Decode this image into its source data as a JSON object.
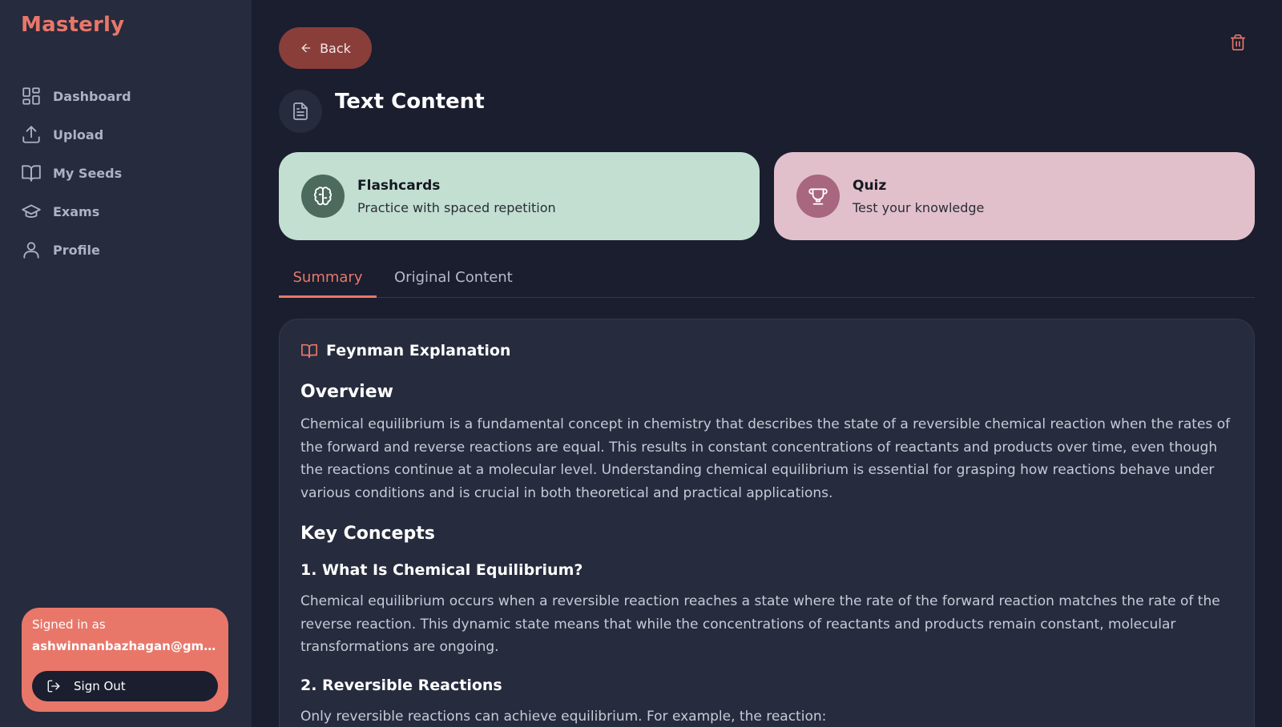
{
  "brand": "Masterly",
  "nav": {
    "items": [
      {
        "label": "Dashboard",
        "icon": "grid-icon"
      },
      {
        "label": "Upload",
        "icon": "upload-icon"
      },
      {
        "label": "My Seeds",
        "icon": "book-icon"
      },
      {
        "label": "Exams",
        "icon": "graduation-cap-icon"
      },
      {
        "label": "Profile",
        "icon": "user-icon"
      }
    ]
  },
  "account": {
    "signed_in_label": "Signed in as",
    "email": "ashwinnanbazhagan@gmai...",
    "sign_out_label": "Sign Out"
  },
  "header": {
    "back_label": "Back",
    "title": "Text Content"
  },
  "cards": {
    "flashcards": {
      "title": "Flashcards",
      "subtitle": "Practice with spaced repetition",
      "icon": "brain-icon"
    },
    "quiz": {
      "title": "Quiz",
      "subtitle": "Test your knowledge",
      "icon": "trophy-icon"
    }
  },
  "tabs": [
    {
      "label": "Summary",
      "active": true
    },
    {
      "label": "Original Content",
      "active": false
    }
  ],
  "content": {
    "section_title": "Feynman Explanation",
    "overview_heading": "Overview",
    "overview_text": "Chemical equilibrium is a fundamental concept in chemistry that describes the state of a reversible chemical reaction when the rates of the forward and reverse reactions are equal. This results in constant concentrations of reactants and products over time, even though the reactions continue at a molecular level. Understanding chemical equilibrium is essential for grasping how reactions behave under various conditions and is crucial in both theoretical and practical applications.",
    "key_concepts_heading": "Key Concepts",
    "concept1_heading": "1. What Is Chemical Equilibrium?",
    "concept1_text": "Chemical equilibrium occurs when a reversible reaction reaches a state where the rate of the forward reaction matches the rate of the reverse reaction. This dynamic state means that while the concentrations of reactants and products remain constant, molecular transformations are ongoing.",
    "concept2_heading": "2. Reversible Reactions",
    "concept2_text": "Only reversible reactions can achieve equilibrium. For example, the reaction:"
  },
  "colors": {
    "accent": "#e8776a",
    "sidebar_bg": "#262b3d",
    "page_bg": "#1a1e2e",
    "flashcards_bg": "#c2dfd2",
    "quiz_bg": "#e1c0cc"
  }
}
